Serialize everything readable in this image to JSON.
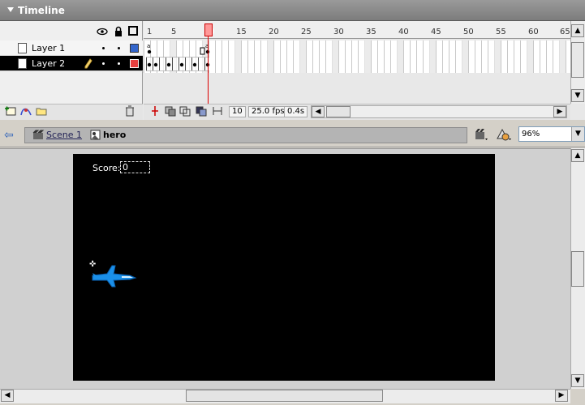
{
  "timeline": {
    "title": "Timeline",
    "ruler_ticks": [
      "1",
      "5",
      "10",
      "15",
      "20",
      "25",
      "30",
      "35",
      "40",
      "45",
      "50",
      "55",
      "60",
      "65"
    ],
    "layers": [
      {
        "name": "Layer 1",
        "color": "#3366cc"
      },
      {
        "name": "Layer 2",
        "color": "#e84040"
      }
    ],
    "status": {
      "current_frame": "10",
      "frame_rate": "25.0 fps",
      "elapsed": "0.4s"
    },
    "icons": [
      "eye-icon",
      "lock-icon",
      "outline-icon",
      "pencil-icon",
      "add-layer-icon",
      "motion-guide-icon",
      "add-folder-icon",
      "delete-layer-icon",
      "center-frame-icon",
      "onion-skin-icon",
      "onion-outlines-icon",
      "edit-multiple-icon",
      "modify-markers-icon"
    ]
  },
  "edit_bar": {
    "scene": "Scene 1",
    "symbol": "hero",
    "zoom": "96%"
  },
  "stage": {
    "background": "#000000",
    "score_label": "Score:",
    "score_value": "0",
    "sprite": "jet-plane"
  }
}
